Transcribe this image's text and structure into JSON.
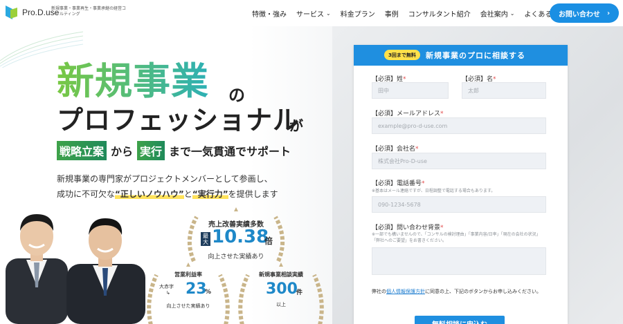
{
  "header": {
    "logo_name": "Pro.D.use",
    "logo_tagline": "新規事業・事業再生・事業承継の経営コンサルティング",
    "nav": [
      {
        "label": "特徴・強み",
        "dropdown": false
      },
      {
        "label": "サービス",
        "dropdown": true
      },
      {
        "label": "料金プラン",
        "dropdown": false
      },
      {
        "label": "事例",
        "dropdown": false
      },
      {
        "label": "コンサルタント紹介",
        "dropdown": false
      },
      {
        "label": "会社案内",
        "dropdown": true
      },
      {
        "label": "よくある質問",
        "dropdown": false
      }
    ],
    "cta_label": "お問い合わせ"
  },
  "hero": {
    "title_line1": "新規事業",
    "title_line1_suffix": "の",
    "title_line2": "プロフェッショナル",
    "title_line2_suffix": "が",
    "tag_highlight1": "戦略立案",
    "tag_mid": "から",
    "tag_highlight2": "実行",
    "tag_end": "まで一気貫通でサポート",
    "desc_line1": "新規事業の専門家がプロジェクトメンバーとして参画し、",
    "desc_line2_a": "成功に不可欠な",
    "desc_line2_em1": "“正しいノウハウ”",
    "desc_line2_b": "と",
    "desc_line2_em2": "“実行力”",
    "desc_line2_c": "を提供します"
  },
  "achievements": {
    "main": {
      "title": "売上改善実績多数",
      "max_label": "最大",
      "value": "10.38",
      "unit": "倍",
      "sub": "向上させた実績あり"
    },
    "left": {
      "title": "営業利益率",
      "sub1": "大赤字",
      "sub2": "↳",
      "value": "23",
      "unit": "%",
      "sub": "向上させた実績あり"
    },
    "right": {
      "title": "新規事業相談実績",
      "value": "300",
      "unit": "件",
      "sub": "以上"
    }
  },
  "form": {
    "pill": "3回まで無料",
    "title": "新規事業のプロに相談する",
    "req_tag": "【必須】",
    "req_mark": "*",
    "last_name_label": "姓",
    "last_name_placeholder": "田中",
    "first_name_label": "名",
    "first_name_placeholder": "太郎",
    "email_label": "メールアドレス",
    "email_placeholder": "example@pro-d-use.com",
    "company_label": "会社名",
    "company_placeholder": "株式会社Pro-D-use",
    "phone_label": "電話番号",
    "phone_hint": "※基本はメール連絡ですが、日程調整で電話する場合もあります。",
    "phone_placeholder": "090-1234-5678",
    "background_label": "問い合わせ背景",
    "background_hint": "※一部でも構いませんので、「コンサルの検討理由」「事業内容/日率」「現在の会社の状況」「弊社へのご要望」をお書きください。",
    "consent_a": "弊社の",
    "consent_link": "個人情報保護方針",
    "consent_b": "に同意の上、下記のボタンからお申し込みください。",
    "submit_label": "無料相談に申込む"
  },
  "colors": {
    "brand_blue": "#1f8fe0",
    "accent_green": "#3ea24a",
    "highlight_yellow": "#ffe25a",
    "value_blue": "#1e88c8"
  }
}
